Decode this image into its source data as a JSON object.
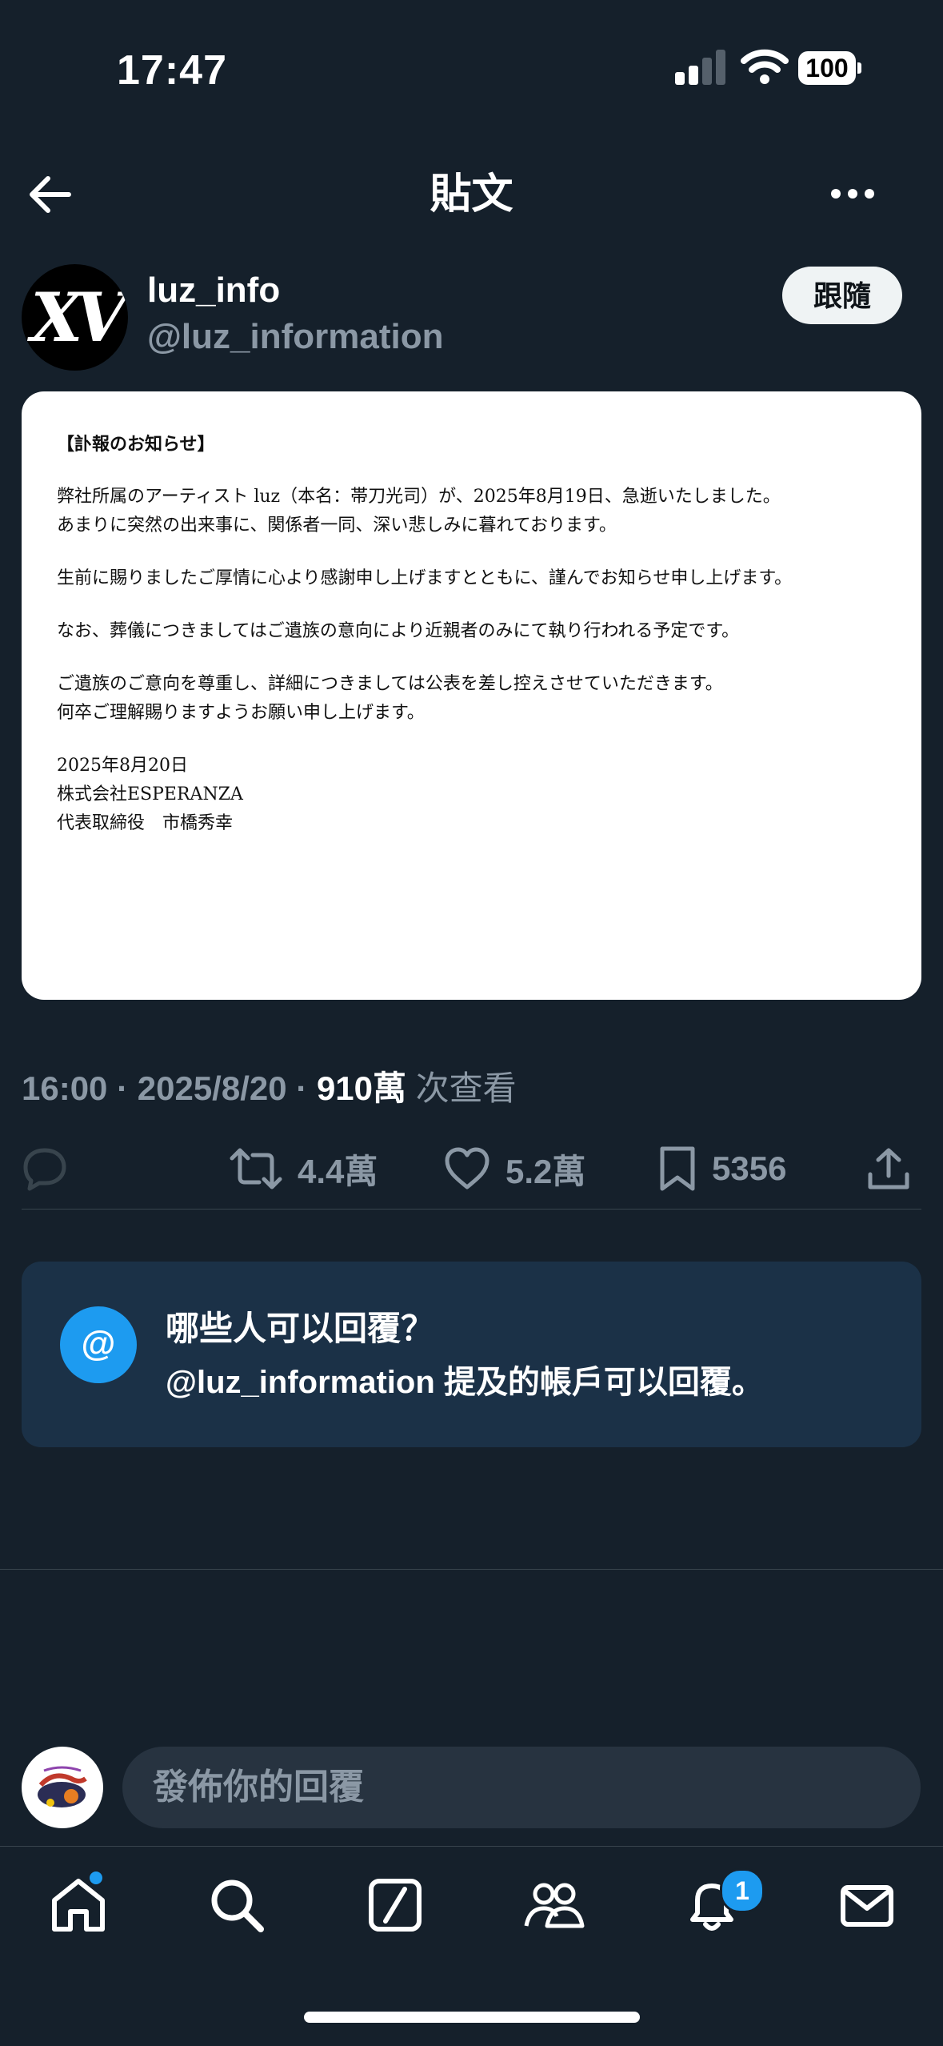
{
  "status_bar": {
    "time": "17:47",
    "battery": "100"
  },
  "header": {
    "title": "貼文"
  },
  "author": {
    "display_name": "luz_info",
    "handle": "@luz_information",
    "follow_label": "跟隨",
    "avatar_text": "XV"
  },
  "post_image": {
    "heading": "【訃報のお知らせ】",
    "lines": [
      "弊社所属のアーティスト luz（本名：帯刀光司）が、2025年8月19日、急逝いたしました。",
      "あまりに突然の出来事に、関係者一同、深い悲しみに暮れております。",
      "生前に賜りましたご厚情に心より感謝申し上げますとともに、謹んでお知らせ申し上げます。",
      "なお、葬儀につきましてはご遺族の意向により近親者のみにて執り行われる予定です。",
      "ご遺族のご意向を尊重し、詳細につきましては公表を差し控えさせていただきます。",
      "何卒ご理解賜りますようお願い申し上げます。",
      "2025年8月20日",
      "株式会社ESPERANZA",
      "代表取締役　市橋秀幸"
    ]
  },
  "meta": {
    "time": "16:00",
    "sep": " · ",
    "date": "2025/8/20",
    "views_count": "910萬",
    "views_label": " 次查看"
  },
  "actions": {
    "reposts": "4.4萬",
    "likes": "5.2萬",
    "bookmarks": "5356"
  },
  "reply_restriction": {
    "icon": "@",
    "title": "哪些人可以回覆？",
    "body_handle": "@luz_information",
    "body_text": " 提及的帳戶可以回覆。"
  },
  "reply_bar": {
    "placeholder": "發佈你的回覆"
  },
  "tab_bar": {
    "notifications_badge": "1"
  },
  "colors": {
    "background": "#15202b",
    "accent": "#1d9bf0",
    "muted": "#8b98a5"
  }
}
